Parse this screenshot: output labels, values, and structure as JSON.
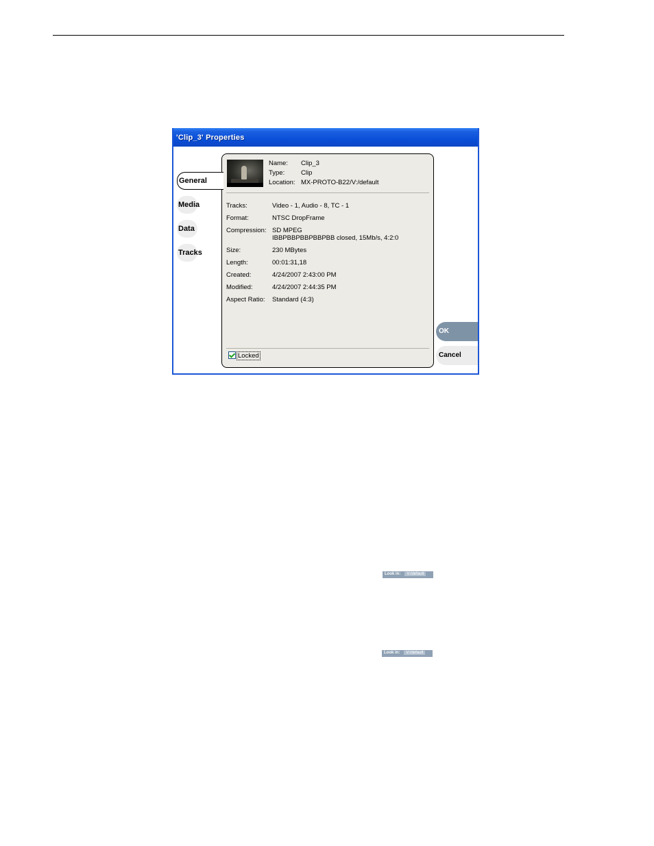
{
  "dialog": {
    "title": "'Clip_3' Properties",
    "tabs": [
      {
        "label": "General",
        "active": true
      },
      {
        "label": "Media",
        "active": false
      },
      {
        "label": "Data",
        "active": false
      },
      {
        "label": "Tracks",
        "active": false
      }
    ],
    "header": {
      "name_label": "Name:",
      "name_value": "Clip_3",
      "type_label": "Type:",
      "type_value": "Clip",
      "location_label": "Location:",
      "location_value": "MX-PROTO-B22/V:/default"
    },
    "properties": {
      "tracks_label": "Tracks:",
      "tracks_value": "Video - 1, Audio - 8, TC - 1",
      "format_label": "Format:",
      "format_value": "NTSC DropFrame",
      "compression_label": "Compression:",
      "compression_value": "SD MPEG",
      "compression_detail": "IBBPBBPBBPBBPBB closed, 15Mb/s, 4:2:0",
      "size_label": "Size:",
      "size_value": "230 MBytes",
      "length_label": "Length:",
      "length_value": "00:01:31,18",
      "created_label": "Created:",
      "created_value": "4/24/2007 2:43:00 PM",
      "modified_label": "Modified:",
      "modified_value": "4/24/2007 2:44:35 PM",
      "aspect_label": "Aspect Ratio:",
      "aspect_value": "Standard (4:3)"
    },
    "locked": {
      "label": "Locked",
      "checked": true
    },
    "buttons": {
      "ok": "OK",
      "cancel": "Cancel"
    },
    "colors": {
      "titlebar": "#0a4fd8",
      "ok_button": "#7f93a6",
      "panel": "#edebe6"
    }
  },
  "lookin_graphics": [
    {
      "label": "Look in:",
      "path": "V:/default"
    },
    {
      "label": "Look in:",
      "path": "V:/default"
    }
  ]
}
